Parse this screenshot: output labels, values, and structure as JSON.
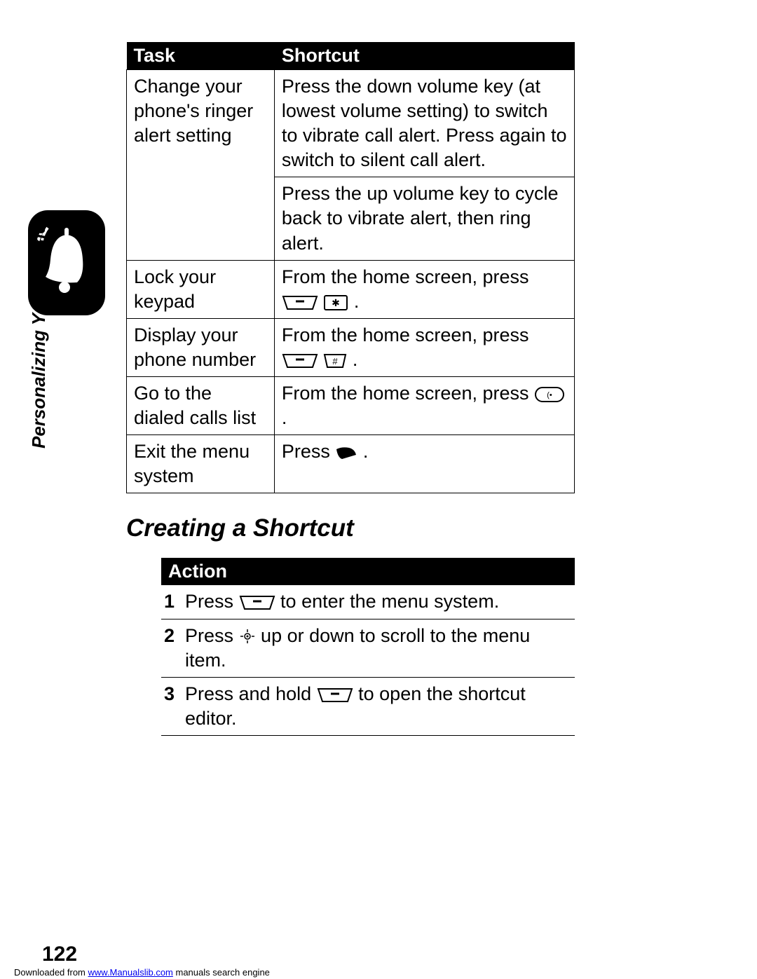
{
  "sidebar_label": "Personalizing Your Phone",
  "page_number": "122",
  "footer_prefix": "Downloaded from ",
  "footer_link": "www.Manualslib.com",
  "footer_suffix": " manuals search engine",
  "tasks_table": {
    "headers": {
      "task": "Task",
      "shortcut": "Shortcut"
    },
    "rows": [
      {
        "task": "Change your phone's ringer alert setting",
        "shortcut_a": "Press the down volume key (at lowest volume setting) to switch to vibrate call alert. Press again to switch to silent call alert.",
        "shortcut_b": "Press the up volume key to cycle back to vibrate alert, then ring alert."
      },
      {
        "task": "Lock your keypad",
        "shortcut_prefix": "From the home screen, press ",
        "shortcut_suffix": ".",
        "keys": [
          "menu",
          "star"
        ]
      },
      {
        "task": "Display your phone number",
        "shortcut_prefix": "From the home screen, press ",
        "shortcut_suffix": ".",
        "keys": [
          "menu",
          "hash"
        ]
      },
      {
        "task": "Go to the dialed calls list",
        "shortcut_prefix": "From the home screen, press ",
        "shortcut_suffix": ".",
        "keys": [
          "send"
        ]
      },
      {
        "task": "Exit the menu system",
        "shortcut_prefix": "Press ",
        "shortcut_suffix": ".",
        "keys": [
          "end"
        ]
      }
    ]
  },
  "section_heading": "Creating a Shortcut",
  "action_table": {
    "header": "Action",
    "rows": [
      {
        "n": "1",
        "pre": "Press ",
        "post": " to enter the menu system.",
        "key": "menu"
      },
      {
        "n": "2",
        "pre": "Press ",
        "post": " up or down to scroll to the menu item.",
        "key": "nav"
      },
      {
        "n": "3",
        "pre": "Press and hold ",
        "post": " to open the shortcut editor.",
        "key": "menu"
      }
    ]
  }
}
